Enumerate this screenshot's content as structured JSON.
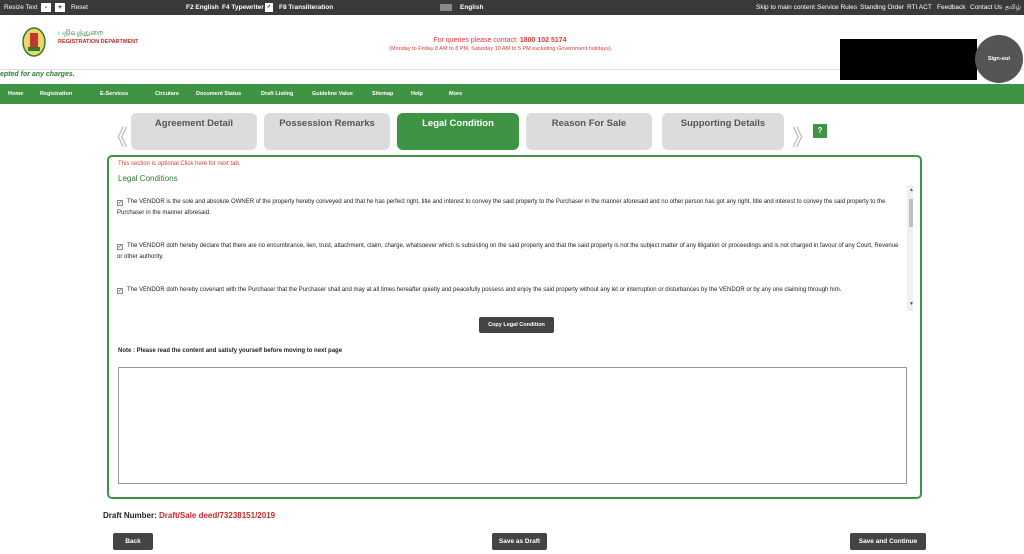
{
  "topbar": {
    "resize_text": "Resize Text",
    "minus": "-",
    "plus": "+",
    "reset": "Reset",
    "f2": "F2 English",
    "f4": "F4 Typewriter",
    "f4_check": "✓",
    "f8": "F8 Transliteration",
    "english": "English",
    "skip": "Skip to main content",
    "service_rules": "Service Rules",
    "standing_order": "Standing Order",
    "rti": "RTI ACT",
    "feedback": "Feedback",
    "contact": "Contact Us",
    "tamil": "தமிழ்"
  },
  "header": {
    "tamil_title": "பதிவுத்துறை",
    "dept_title": "REGISTRATION DEPARTMENT",
    "query_prefix": "For queries please contact:",
    "query_number": "1800 102 5174",
    "timings": "(Monday to Friday 8 AM to 8 PM, Saturday 10 AM to 5 PM excluding Government holidays)",
    "signout": "Sign-out"
  },
  "ticker": "epted for any charges.",
  "nav": {
    "items": [
      "Home",
      "Registration",
      "E-Services",
      "Circulars",
      "Document Status",
      "Draft Listing",
      "Guideline Value",
      "Sitemap",
      "Help",
      "More"
    ]
  },
  "tabs": {
    "prev": "《",
    "next": "》",
    "items": [
      "Agreement Detail",
      "Possession Remarks",
      "Legal Condition",
      "Reason For Sale",
      "Supporting Details"
    ],
    "active": "Legal Condition",
    "help": "?"
  },
  "panel": {
    "optional": "This section is optional Click here for next tab.",
    "title": "Legal Conditions",
    "check": "✓",
    "conditions": [
      "The VENDOR is the sole and absolute OWNER of the property hereby conveyed and that he has perfect right, title and interest to convey the said property to the Purchaser in the manner aforesaid and no other person has got any right, title and interest to convey the said property to the Purchaser in the manner aforesaid.",
      "The VENDOR doth hereby declare that there are no encumbrance, lien, trust, attachment, claim, charge, whatsoever which is subsisting on the said property and that the said property is not the subject matter of any litigation or proceedings and is not charged in favour of any Court, Revenue or other authority.",
      "The VENDOR doth hereby covenant with the Purchaser that the Purchaser shall and may at all times hereafter quietly and peacefully possess and enjoy the said property without any let or interruption or disturbances by the VENDOR or by any one claiming through him."
    ],
    "copy_button": "Copy Legal Condition",
    "note": "Note : Please read the content and satisfy yourself before moving to next page",
    "textarea_value": ""
  },
  "footer": {
    "draft_label": "Draft Number:",
    "draft_number": "Draft/Sale deed/73238151/2019",
    "back": "Back",
    "save_draft": "Save as Draft",
    "save_continue": "Save and Continue"
  },
  "colors": {
    "brand_green": "#3f9444",
    "alert_red": "#e53935",
    "topbar": "#3a3a3a"
  }
}
